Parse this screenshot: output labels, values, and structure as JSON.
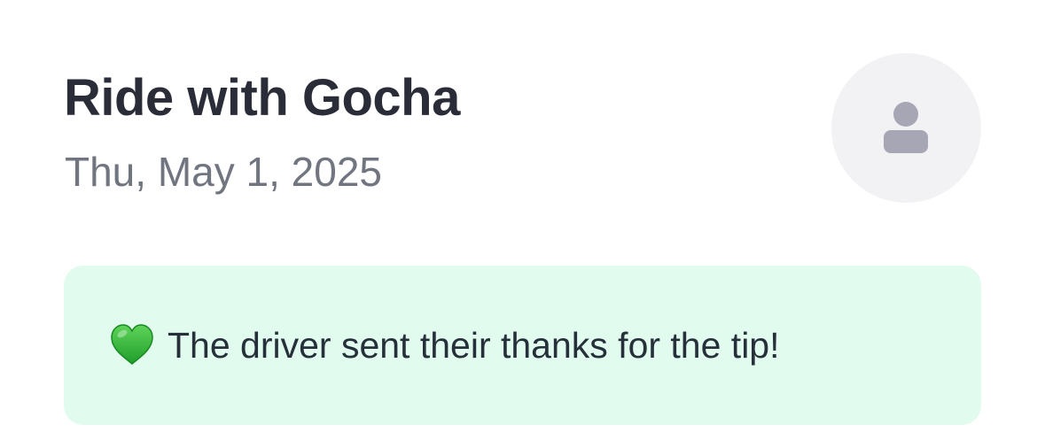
{
  "header": {
    "title": "Ride with Gocha",
    "date": "Thu, May 1, 2025"
  },
  "avatar": {
    "icon": "person-icon",
    "background": "#f2f2f5",
    "icon_color": "#a6a6b4"
  },
  "banner": {
    "icon": "green-heart-icon",
    "message": "The driver sent their thanks for the tip!",
    "background": "#e2fbef"
  }
}
